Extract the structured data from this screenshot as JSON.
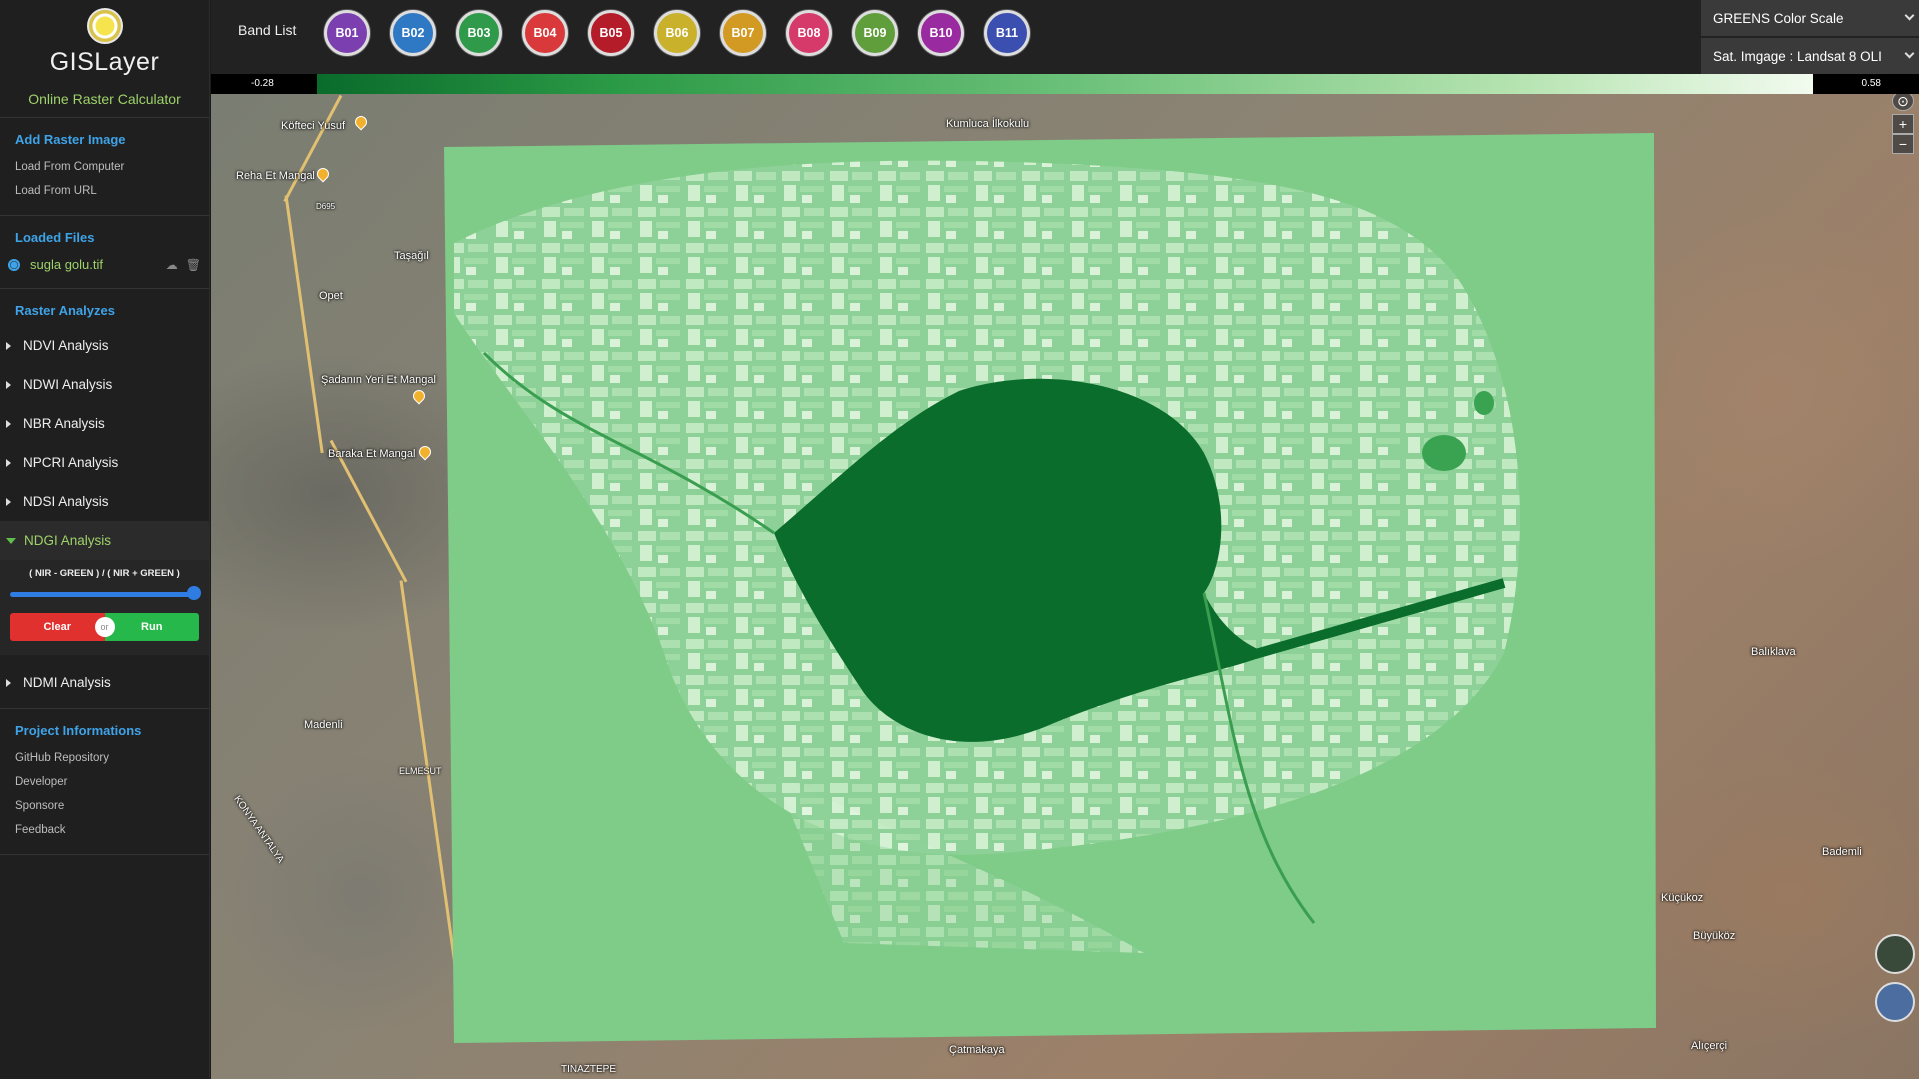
{
  "app": {
    "name": "GISLayer",
    "subtitle": "Online Raster Calculator"
  },
  "sidebar": {
    "add_raster": {
      "title": "Add Raster Image",
      "items": [
        "Load From Computer",
        "Load From URL"
      ]
    },
    "loaded_files": {
      "title": "Loaded Files",
      "files": [
        {
          "name": "sugla golu.tif",
          "selected": true
        }
      ]
    },
    "raster_analyzes": {
      "title": "Raster Analyzes",
      "items": [
        {
          "label": "NDVI Analysis",
          "expanded": false
        },
        {
          "label": "NDWI Analysis",
          "expanded": false
        },
        {
          "label": "NBR Analysis",
          "expanded": false
        },
        {
          "label": "NPCRI Analysis",
          "expanded": false
        },
        {
          "label": "NDSI Analysis",
          "expanded": false
        },
        {
          "label": "NDGI Analysis",
          "expanded": true
        },
        {
          "label": "NDMI Analysis",
          "expanded": false
        }
      ],
      "ndgi": {
        "formula": "( NIR - GREEN ) / ( NIR + GREEN )",
        "slider_value": 1.0,
        "clear_label": "Clear",
        "or_label": "or",
        "run_label": "Run"
      }
    },
    "project": {
      "title": "Project Informations",
      "items": [
        "GitHub Repository",
        "Developer",
        "Sponsore",
        "Feedback"
      ]
    }
  },
  "topbar": {
    "band_list_label": "Band List",
    "bands": [
      {
        "label": "B01",
        "color": "#7b3fb0"
      },
      {
        "label": "B02",
        "color": "#2f78c4"
      },
      {
        "label": "B03",
        "color": "#2f9a4a"
      },
      {
        "label": "B04",
        "color": "#d9393a"
      },
      {
        "label": "B05",
        "color": "#b51c2a"
      },
      {
        "label": "B06",
        "color": "#c9b12c"
      },
      {
        "label": "B07",
        "color": "#d39a23"
      },
      {
        "label": "B08",
        "color": "#d63a6a"
      },
      {
        "label": "B09",
        "color": "#5f9e3b"
      },
      {
        "label": "B10",
        "color": "#9a2aa0"
      },
      {
        "label": "B11",
        "color": "#3b4fb0"
      }
    ],
    "color_scale": "GREENS Color Scale",
    "sat_image": "Sat. Imgage : Landsat 8 OLI"
  },
  "scale_bar": {
    "min": "-0.28",
    "max": "0.58"
  },
  "map": {
    "places": [
      "Kumluca İlkokulu",
      "Köfteci Yusuf",
      "Reha Et Mangal",
      "Taşağıl",
      "Opet",
      "Şadanın Yeri Et Mangal",
      "Baraka Et Mangal",
      "Madenli",
      "ELMESUT",
      "Çatmakaya",
      "Balıklava",
      "Bademli",
      "Küçükoz",
      "Büyüköz",
      "Alıçerçi",
      "TINAZTEPE",
      "KONYA ANTALYA",
      "D695"
    ]
  }
}
